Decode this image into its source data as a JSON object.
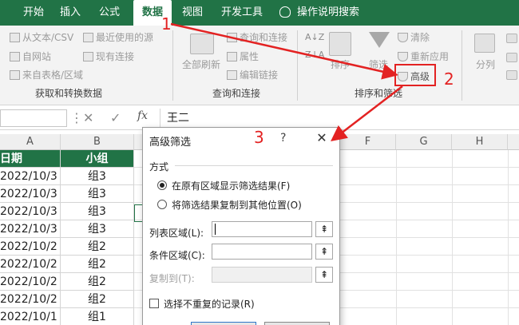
{
  "tabs": [
    {
      "label": "开始"
    },
    {
      "label": "插入"
    },
    {
      "label": "公式"
    },
    {
      "label": "数据"
    },
    {
      "label": "视图"
    },
    {
      "label": "开发工具"
    }
  ],
  "tell_me": "操作说明搜索",
  "ribbon": {
    "get_data": {
      "from_text": "从文本/CSV",
      "from_web": "自网站",
      "from_table": "来自表格/区域",
      "recent_sources": "最近使用的源",
      "existing_conn": "现有连接",
      "group_label": "获取和转换数据"
    },
    "queries": {
      "refresh_all": "全部刷新",
      "queries_conn": "查询和连接",
      "properties": "属性",
      "edit_links": "编辑链接",
      "group_label": "查询和连接"
    },
    "sort_filter": {
      "sort": "排序",
      "filter": "筛选",
      "clear": "清除",
      "reapply": "重新应用",
      "advanced": "高级",
      "group_label": "排序和筛选"
    },
    "tools": {
      "split": "分列"
    }
  },
  "formula_bar": {
    "fx": "fx",
    "value": "王二"
  },
  "grid": {
    "columns": [
      "A",
      "B",
      "C",
      "D",
      "E",
      "F",
      "G",
      "H"
    ],
    "header_row": [
      "日期",
      "小组"
    ],
    "rows": [
      [
        "2022/10/3",
        "组3"
      ],
      [
        "2022/10/3",
        "组3"
      ],
      [
        "2022/10/3",
        "组3"
      ],
      [
        "2022/10/3",
        "组3"
      ],
      [
        "2022/10/2",
        "组2"
      ],
      [
        "2022/10/2",
        "组2"
      ],
      [
        "2022/10/2",
        "组2"
      ],
      [
        "2022/10/2",
        "组2"
      ],
      [
        "2022/10/1",
        "组1"
      ]
    ]
  },
  "dialog": {
    "title": "高级筛选",
    "help": "?",
    "close": "✕",
    "section": "方式",
    "option_inplace": "在原有区域显示筛选结果(F)",
    "option_copy": "将筛选结果复制到其他位置(O)",
    "list_range_label": "列表区域(L):",
    "criteria_range_label": "条件区域(C):",
    "copy_to_label": "复制到(T):",
    "collapse_glyph": "⇞",
    "unique_label": "选择不重复的记录(R)"
  },
  "annotations": {
    "n1": "1",
    "n2": "2",
    "n3": "3",
    "color": "#e32222"
  },
  "colors": {
    "excel_green": "#217346",
    "annotation_red": "#e32222"
  }
}
